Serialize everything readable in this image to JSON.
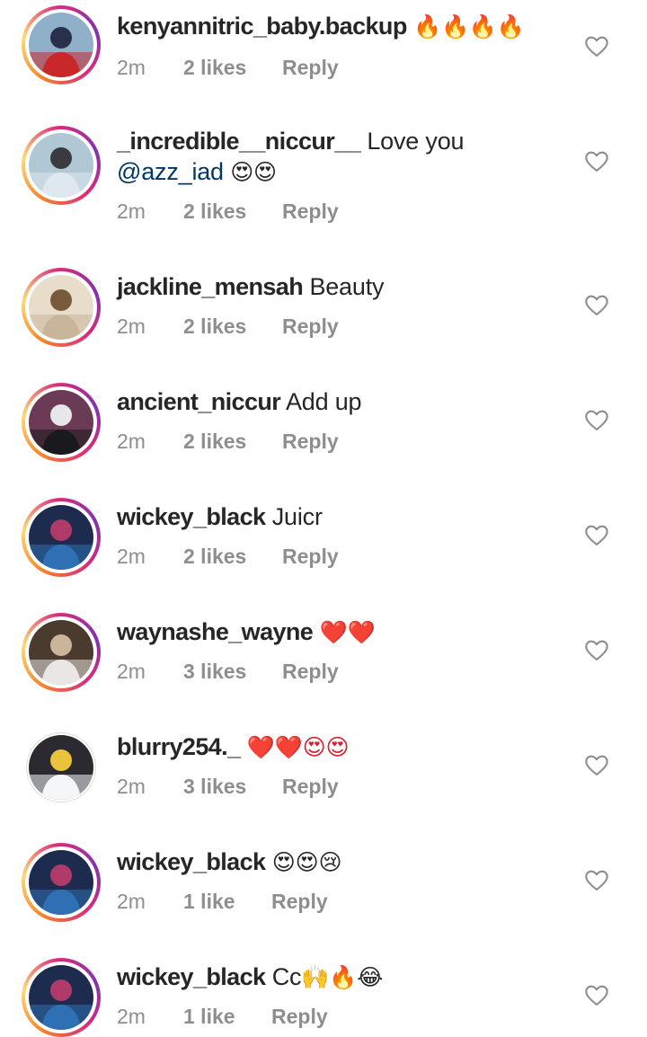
{
  "comments": [
    {
      "username": "kenyannitric_baby.backup",
      "text": "",
      "emoji": "🔥🔥🔥🔥",
      "time": "2m",
      "likes": "2 likes",
      "reply": "Reply",
      "story": true,
      "avatar_colors": [
        "#c8282a",
        "#2a2f4a",
        "#8fb0c8"
      ]
    },
    {
      "username": "_incredible__niccur__",
      "text": "Love you",
      "mention": "@azz_iad",
      "emoji": "😍😍",
      "time": "2m",
      "likes": "2 likes",
      "reply": "Reply",
      "story": true,
      "avatar_colors": [
        "#dfe8ef",
        "#3a3a40",
        "#b0c7d4"
      ]
    },
    {
      "username": "jackline_mensah",
      "text": "Beauty",
      "emoji": "",
      "time": "2m",
      "likes": "2 likes",
      "reply": "Reply",
      "story": true,
      "avatar_colors": [
        "#c9b69a",
        "#7a5a3c",
        "#e8dccb"
      ]
    },
    {
      "username": "ancient_niccur",
      "text": "Add up",
      "emoji": "",
      "time": "2m",
      "likes": "2 likes",
      "reply": "Reply",
      "story": true,
      "avatar_colors": [
        "#1a1a1e",
        "#e7e7ea",
        "#6b3b55"
      ]
    },
    {
      "username": "wickey_black",
      "text": "Juicr",
      "emoji": "",
      "time": "2m",
      "likes": "2 likes",
      "reply": "Reply",
      "story": true,
      "avatar_colors": [
        "#2f6fb3",
        "#b03a6a",
        "#1d2b4f"
      ]
    },
    {
      "username": "waynashe_wayne",
      "text": "",
      "emoji": "❤️❤️",
      "time": "2m",
      "likes": "3 likes",
      "reply": "Reply",
      "story": true,
      "avatar_colors": [
        "#e9e6e4",
        "#cbb59a",
        "#4b3a2e"
      ]
    },
    {
      "username": "blurry254._",
      "text": "",
      "emoji": "❤️❤️😍😍",
      "time": "2m",
      "likes": "3 likes",
      "reply": "Reply",
      "story": false,
      "avatar_colors": [
        "#f4f6f8",
        "#e9c33a",
        "#2a2a30"
      ]
    },
    {
      "username": "wickey_black",
      "text": "",
      "emoji": "😍😍😢",
      "time": "2m",
      "likes": "1 like",
      "reply": "Reply",
      "story": true,
      "avatar_colors": [
        "#2f6fb3",
        "#b03a6a",
        "#1d2b4f"
      ]
    },
    {
      "username": "wickey_black",
      "text": "Cc",
      "emoji": "🙌🔥😂",
      "time": "2m",
      "likes": "1 like",
      "reply": "Reply",
      "story": true,
      "avatar_colors": [
        "#2f6fb3",
        "#b03a6a",
        "#1d2b4f"
      ]
    }
  ],
  "icons": {
    "like": "heart-outline-icon"
  },
  "colors": {
    "username": "#262626",
    "meta": "#8e8e8e",
    "mention": "#00376b"
  }
}
